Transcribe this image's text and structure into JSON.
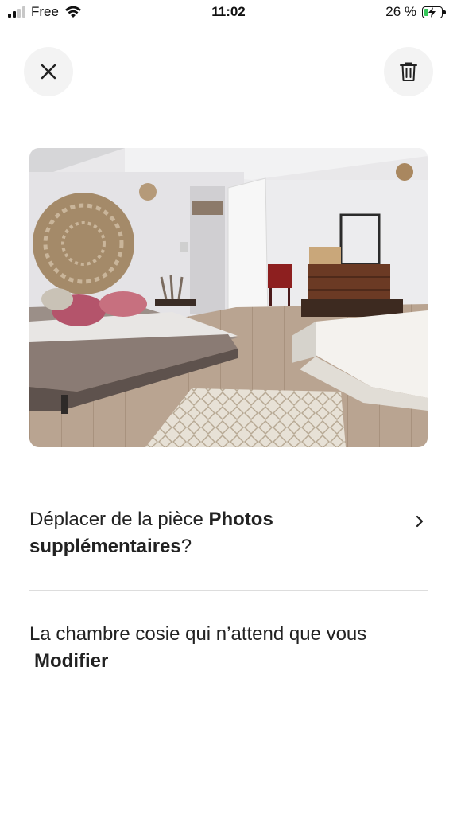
{
  "status_bar": {
    "carrier": "Free",
    "time": "11:02",
    "battery": "26 %",
    "battery_level": 0.26
  },
  "header": {
    "close_icon": "close-icon",
    "delete_icon": "trash-icon"
  },
  "photo": {
    "subject": "bedroom-photo"
  },
  "move_prompt": {
    "prefix": "Déplacer de la pièce",
    "room": "Photos supplémentaires",
    "suffix": "?"
  },
  "caption": {
    "text": "La chambre cosie qui n’attend que vous",
    "edit_label": "Modifier"
  }
}
